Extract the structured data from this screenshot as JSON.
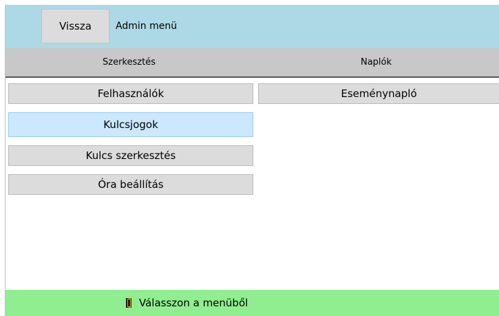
{
  "header": {
    "back_label": "Vissza",
    "title": "Admin menü"
  },
  "tabs": [
    {
      "label": "Szerkesztés"
    },
    {
      "label": "Naplók"
    }
  ],
  "editing": {
    "items": [
      {
        "label": "Felhasználók",
        "selected": false
      },
      {
        "label": "Kulcsjogok",
        "selected": true
      },
      {
        "label": "Kulcs szerkesztés",
        "selected": false
      },
      {
        "label": "Óra beállítás",
        "selected": false
      }
    ]
  },
  "logs": {
    "items": [
      {
        "label": "Eseménynapló"
      }
    ]
  },
  "status": {
    "icon": "door-icon",
    "text": "Válasszon a menüből"
  },
  "colors": {
    "header_bg": "#add8e6",
    "tab_bg": "#c8c8c8",
    "status_bg": "#90ee90",
    "selected_bg": "#cce8ff"
  }
}
